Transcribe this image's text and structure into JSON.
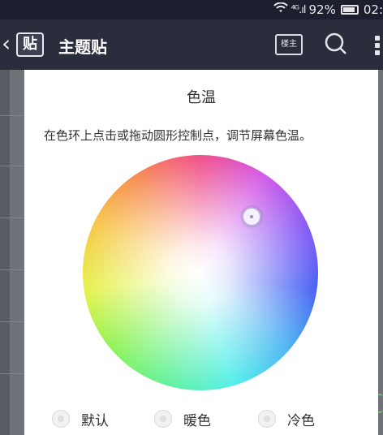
{
  "status_bar": {
    "signal": "⁴ᴳ.ıl",
    "battery": "92%",
    "time": "02:"
  },
  "title_bar": {
    "back": "‹",
    "logo": "贴",
    "title": "主题贴",
    "owner_button": "楼主"
  },
  "dialog": {
    "title": "色温",
    "description": "在色环上点击或拖动圆形控制点，调节屏幕色温。",
    "options": [
      {
        "label": "默认"
      },
      {
        "label": "暖色"
      },
      {
        "label": "冷色"
      }
    ]
  },
  "colors": {
    "status_bar": "#1d1f2e",
    "title_bar": "#2a2d3c",
    "dialog_bg": "#ffffff",
    "overlay": "#6f7278"
  }
}
